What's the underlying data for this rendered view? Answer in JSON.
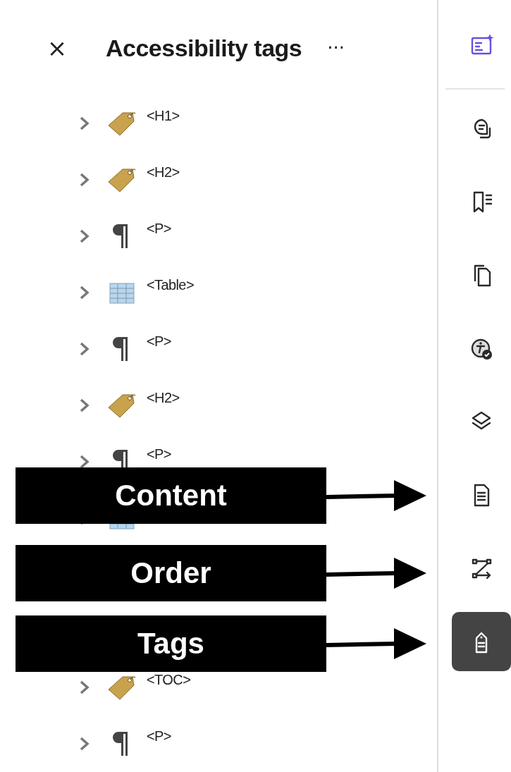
{
  "panel": {
    "close": "×",
    "title": "Accessibility tags",
    "more": "···"
  },
  "tags": [
    {
      "kind": "tag",
      "label": "<H1>"
    },
    {
      "kind": "tag",
      "label": "<H2>"
    },
    {
      "kind": "paragraph",
      "label": "<P>"
    },
    {
      "kind": "table",
      "label": "<Table>"
    },
    {
      "kind": "paragraph",
      "label": "<P>"
    },
    {
      "kind": "tag",
      "label": "<H2>"
    },
    {
      "kind": "paragraph",
      "label": "<P>"
    },
    {
      "kind": "table"
    }
  ],
  "tags_after": [
    {
      "kind": "tag",
      "label": "<TOC>"
    },
    {
      "kind": "paragraph",
      "label": "<P>"
    }
  ],
  "rail": [
    {
      "kind": "ai",
      "selected": false
    },
    {
      "kind": "comment",
      "selected": false
    },
    {
      "kind": "bookmark",
      "selected": false
    },
    {
      "kind": "pages",
      "selected": false
    },
    {
      "kind": "accessibility",
      "selected": false
    },
    {
      "kind": "layers",
      "selected": false
    },
    {
      "kind": "content",
      "selected": false
    },
    {
      "kind": "order",
      "selected": false
    },
    {
      "kind": "tags",
      "selected": true
    }
  ],
  "callouts": [
    {
      "label": "Content"
    },
    {
      "label": "Order"
    },
    {
      "label": "Tags"
    }
  ]
}
